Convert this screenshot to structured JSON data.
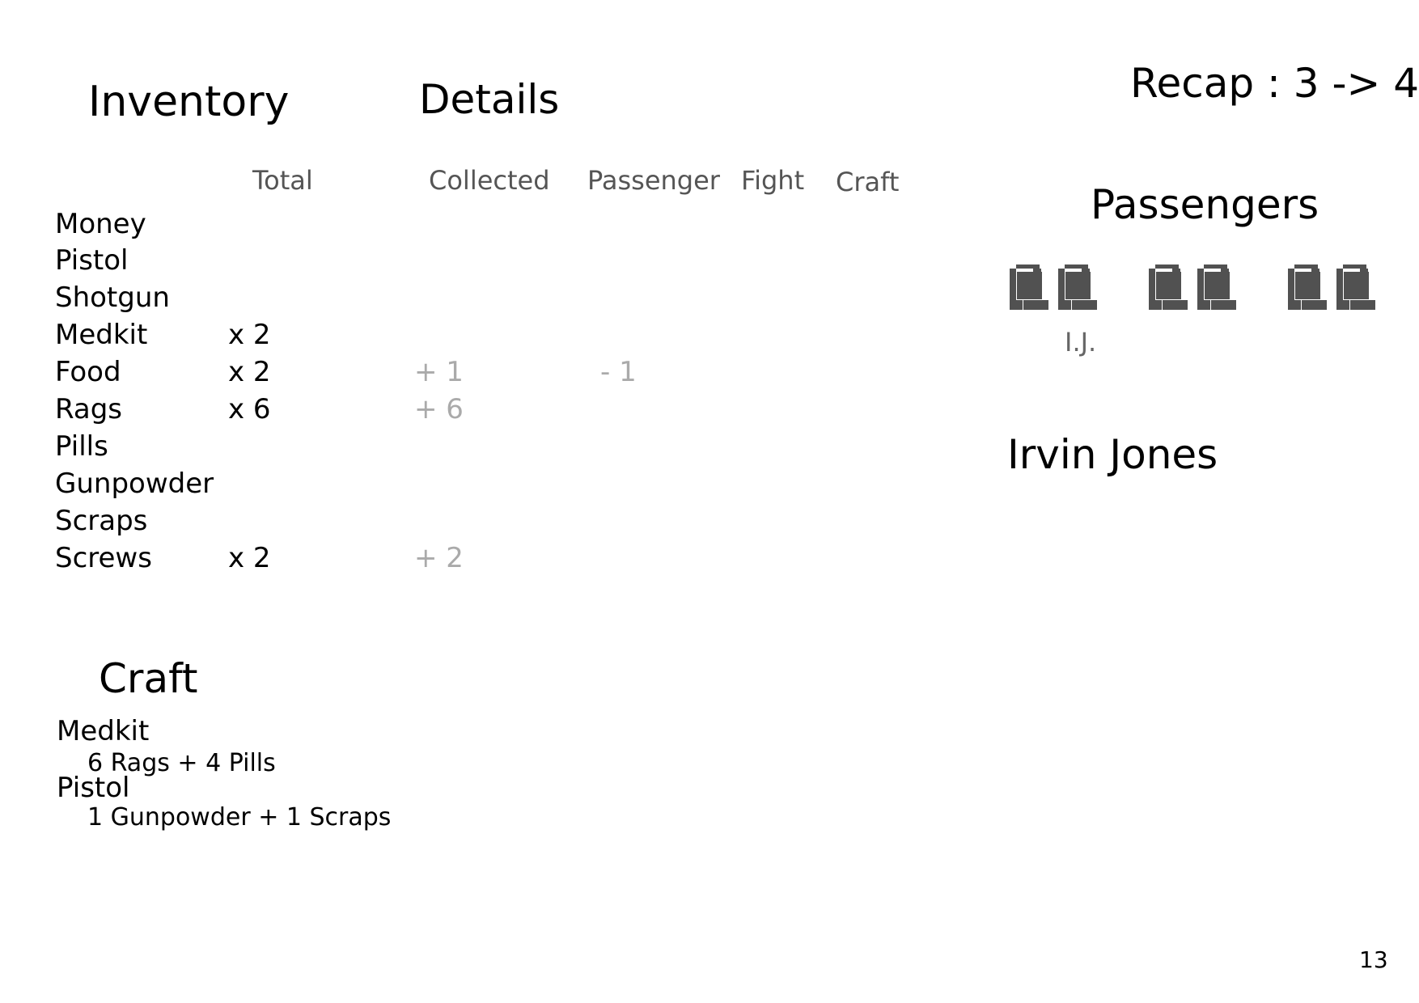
{
  "recap": "Recap : 3 -> 4",
  "inventory": {
    "title": "Inventory",
    "columns": {
      "total": "Total"
    },
    "items": [
      {
        "name": "Money",
        "total": "",
        "collected": "",
        "passenger": ""
      },
      {
        "name": "Pistol",
        "total": "",
        "collected": "",
        "passenger": ""
      },
      {
        "name": "Shotgun",
        "total": "",
        "collected": "",
        "passenger": ""
      },
      {
        "name": "Medkit",
        "total": "x 2",
        "collected": "",
        "passenger": ""
      },
      {
        "name": "Food",
        "total": "x 2",
        "collected": "+ 1",
        "passenger": "- 1"
      },
      {
        "name": "Rags",
        "total": "x 6",
        "collected": "+ 6",
        "passenger": ""
      },
      {
        "name": "Pills",
        "total": "",
        "collected": "",
        "passenger": ""
      },
      {
        "name": "Gunpowder",
        "total": "",
        "collected": "",
        "passenger": ""
      },
      {
        "name": "Scraps",
        "total": "",
        "collected": "",
        "passenger": ""
      },
      {
        "name": "Screws",
        "total": "x 2",
        "collected": "+ 2",
        "passenger": ""
      }
    ]
  },
  "details": {
    "title": "Details",
    "columns": {
      "collected": "Collected",
      "passenger": "Passenger",
      "fight": "Fight",
      "craft": "Craft"
    }
  },
  "passengers": {
    "title": "Passengers",
    "seat_count": 6,
    "seat_label": "I.J.",
    "selected_name": "Irvin Jones"
  },
  "craft": {
    "title": "Craft",
    "recipes": [
      {
        "name": "Medkit",
        "recipe": "6 Rags + 4 Pills"
      },
      {
        "name": "Pistol",
        "recipe": "1 Gunpowder + 1 Scraps"
      }
    ]
  },
  "page_number": "13",
  "colors": {
    "seat": "#515151",
    "muted": "#aaaaaa",
    "header": "#555555"
  }
}
